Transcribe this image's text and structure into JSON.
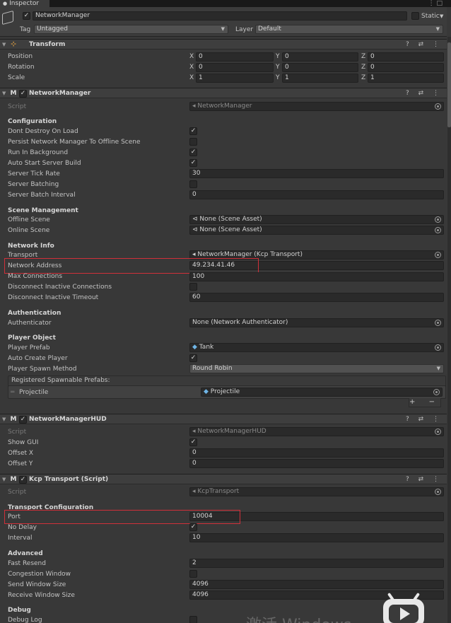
{
  "window": {
    "tab_title": "Inspector",
    "tab_icons": "⋮ □"
  },
  "gameobject": {
    "name": "NetworkManager",
    "static_label": "Static",
    "tag_label": "Tag",
    "tag_value": "Untagged",
    "layer_label": "Layer",
    "layer_value": "Default"
  },
  "transform": {
    "title": "Transform",
    "rows": [
      {
        "label": "Position",
        "x": "0",
        "y": "0",
        "z": "0"
      },
      {
        "label": "Rotation",
        "x": "0",
        "y": "0",
        "z": "0"
      },
      {
        "label": "Scale",
        "x": "1",
        "y": "1",
        "z": "1"
      }
    ],
    "axis": {
      "x": "X",
      "y": "Y",
      "z": "Z"
    }
  },
  "component_buttons": "? ⇄ ⋮",
  "network_manager": {
    "title": "NetworkManager",
    "script_label": "Script",
    "script_value": "NetworkManager",
    "configuration": "Configuration",
    "dont_destroy": "Dont Destroy On Load",
    "persist": "Persist Network Manager To Offline Scene",
    "run_bg": "Run In Background",
    "auto_start": "Auto Start Server Build",
    "tick_rate_label": "Server Tick Rate",
    "tick_rate": "30",
    "batching": "Server Batching",
    "batch_interval_label": "Server Batch Interval",
    "batch_interval": "0",
    "scene_mgmt": "Scene Management",
    "offline_scene_label": "Offline Scene",
    "offline_scene": "None (Scene Asset)",
    "online_scene_label": "Online Scene",
    "online_scene": "None (Scene Asset)",
    "network_info": "Network Info",
    "transport_label": "Transport",
    "transport": "NetworkManager (Kcp Transport)",
    "address_label": "Network Address",
    "address": "49.234.41.46",
    "max_conn_label": "Max Connections",
    "max_conn": "100",
    "disc_inactive": "Disconnect Inactive Connections",
    "disc_timeout_label": "Disconnect Inactive Timeout",
    "disc_timeout": "60",
    "authentication": "Authentication",
    "authenticator_label": "Authenticator",
    "authenticator": "None (Network Authenticator)",
    "player_object": "Player Object",
    "player_prefab_label": "Player Prefab",
    "player_prefab": "Tank",
    "auto_create": "Auto Create Player",
    "spawn_method_label": "Player Spawn Method",
    "spawn_method": "Round Robin",
    "spawnable_header": "Registered Spawnable Prefabs:",
    "spawnable_item_label": "Projectile",
    "spawnable_item_value": "Projectile",
    "plus_minus": "+ −"
  },
  "hud": {
    "title": "NetworkManagerHUD",
    "script_label": "Script",
    "script_value": "NetworkManagerHUD",
    "show_gui": "Show GUI",
    "offset_x_label": "Offset X",
    "offset_x": "0",
    "offset_y_label": "Offset Y",
    "offset_y": "0"
  },
  "kcp": {
    "title": "Kcp Transport (Script)",
    "script_label": "Script",
    "script_value": "KcpTransport",
    "transport_config": "Transport Configuration",
    "port_label": "Port",
    "port": "10004",
    "no_delay": "No Delay",
    "interval_label": "Interval",
    "interval": "10",
    "advanced": "Advanced",
    "fast_resend_label": "Fast Resend",
    "fast_resend": "2",
    "congestion": "Congestion Window",
    "send_window_label": "Send Window Size",
    "send_window": "4096",
    "recv_window_label": "Receive Window Size",
    "recv_window": "4096",
    "debug": "Debug",
    "debug_log": "Debug Log"
  },
  "overlay": {
    "watermark": "激活 Windows"
  },
  "colors": {
    "background": "#383838",
    "highlight_box": "#d0303a",
    "field": "#2a2a2a"
  }
}
